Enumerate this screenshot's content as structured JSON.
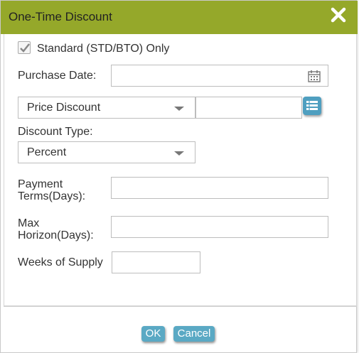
{
  "dialog": {
    "title": "One-Time Discount",
    "close_icon": "close-icon",
    "accent_color": "#95a82a",
    "button_color": "#5aa9c4"
  },
  "form": {
    "standard_only": {
      "label": "Standard (STD/BTO) Only",
      "checked": true
    },
    "purchase_date": {
      "label": "Purchase Date:",
      "value": "",
      "icon": "calendar-icon"
    },
    "discount_mode": {
      "selected": "Price Discount",
      "value": "",
      "list_icon": "list-icon"
    },
    "discount_type": {
      "label": "Discount Type:",
      "selected": "Percent"
    },
    "payment_terms": {
      "label_line1": "Payment",
      "label_line2": "Terms(Days):",
      "value": ""
    },
    "max_horizon": {
      "label_line1": "Max",
      "label_line2": "Horizon(Days):",
      "value": ""
    },
    "weeks_of_supply": {
      "label": "Weeks of Supply",
      "value": ""
    }
  },
  "footer": {
    "ok_label": "OK",
    "cancel_label": "Cancel"
  }
}
